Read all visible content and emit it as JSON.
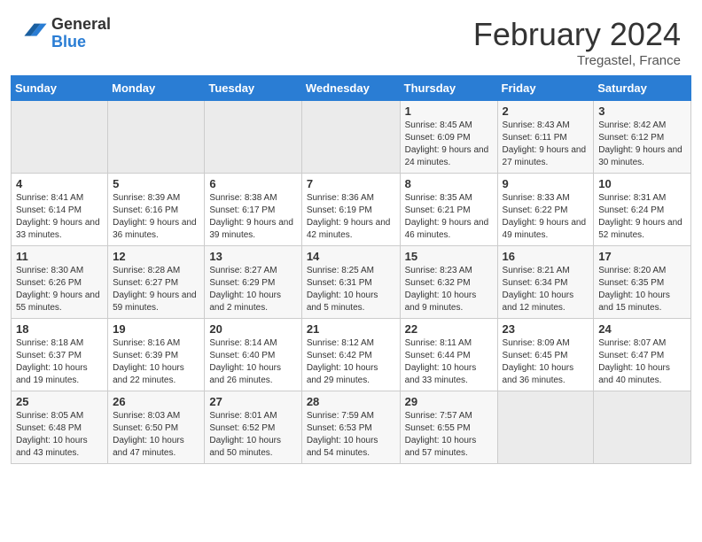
{
  "header": {
    "logo": {
      "line1": "General",
      "line2": "Blue"
    },
    "title": "February 2024",
    "subtitle": "Tregastel, France"
  },
  "weekdays": [
    "Sunday",
    "Monday",
    "Tuesday",
    "Wednesday",
    "Thursday",
    "Friday",
    "Saturday"
  ],
  "weeks": [
    [
      {
        "day": "",
        "info": ""
      },
      {
        "day": "",
        "info": ""
      },
      {
        "day": "",
        "info": ""
      },
      {
        "day": "",
        "info": ""
      },
      {
        "day": "1",
        "info": "Sunrise: 8:45 AM\nSunset: 6:09 PM\nDaylight: 9 hours and 24 minutes."
      },
      {
        "day": "2",
        "info": "Sunrise: 8:43 AM\nSunset: 6:11 PM\nDaylight: 9 hours and 27 minutes."
      },
      {
        "day": "3",
        "info": "Sunrise: 8:42 AM\nSunset: 6:12 PM\nDaylight: 9 hours and 30 minutes."
      }
    ],
    [
      {
        "day": "4",
        "info": "Sunrise: 8:41 AM\nSunset: 6:14 PM\nDaylight: 9 hours and 33 minutes."
      },
      {
        "day": "5",
        "info": "Sunrise: 8:39 AM\nSunset: 6:16 PM\nDaylight: 9 hours and 36 minutes."
      },
      {
        "day": "6",
        "info": "Sunrise: 8:38 AM\nSunset: 6:17 PM\nDaylight: 9 hours and 39 minutes."
      },
      {
        "day": "7",
        "info": "Sunrise: 8:36 AM\nSunset: 6:19 PM\nDaylight: 9 hours and 42 minutes."
      },
      {
        "day": "8",
        "info": "Sunrise: 8:35 AM\nSunset: 6:21 PM\nDaylight: 9 hours and 46 minutes."
      },
      {
        "day": "9",
        "info": "Sunrise: 8:33 AM\nSunset: 6:22 PM\nDaylight: 9 hours and 49 minutes."
      },
      {
        "day": "10",
        "info": "Sunrise: 8:31 AM\nSunset: 6:24 PM\nDaylight: 9 hours and 52 minutes."
      }
    ],
    [
      {
        "day": "11",
        "info": "Sunrise: 8:30 AM\nSunset: 6:26 PM\nDaylight: 9 hours and 55 minutes."
      },
      {
        "day": "12",
        "info": "Sunrise: 8:28 AM\nSunset: 6:27 PM\nDaylight: 9 hours and 59 minutes."
      },
      {
        "day": "13",
        "info": "Sunrise: 8:27 AM\nSunset: 6:29 PM\nDaylight: 10 hours and 2 minutes."
      },
      {
        "day": "14",
        "info": "Sunrise: 8:25 AM\nSunset: 6:31 PM\nDaylight: 10 hours and 5 minutes."
      },
      {
        "day": "15",
        "info": "Sunrise: 8:23 AM\nSunset: 6:32 PM\nDaylight: 10 hours and 9 minutes."
      },
      {
        "day": "16",
        "info": "Sunrise: 8:21 AM\nSunset: 6:34 PM\nDaylight: 10 hours and 12 minutes."
      },
      {
        "day": "17",
        "info": "Sunrise: 8:20 AM\nSunset: 6:35 PM\nDaylight: 10 hours and 15 minutes."
      }
    ],
    [
      {
        "day": "18",
        "info": "Sunrise: 8:18 AM\nSunset: 6:37 PM\nDaylight: 10 hours and 19 minutes."
      },
      {
        "day": "19",
        "info": "Sunrise: 8:16 AM\nSunset: 6:39 PM\nDaylight: 10 hours and 22 minutes."
      },
      {
        "day": "20",
        "info": "Sunrise: 8:14 AM\nSunset: 6:40 PM\nDaylight: 10 hours and 26 minutes."
      },
      {
        "day": "21",
        "info": "Sunrise: 8:12 AM\nSunset: 6:42 PM\nDaylight: 10 hours and 29 minutes."
      },
      {
        "day": "22",
        "info": "Sunrise: 8:11 AM\nSunset: 6:44 PM\nDaylight: 10 hours and 33 minutes."
      },
      {
        "day": "23",
        "info": "Sunrise: 8:09 AM\nSunset: 6:45 PM\nDaylight: 10 hours and 36 minutes."
      },
      {
        "day": "24",
        "info": "Sunrise: 8:07 AM\nSunset: 6:47 PM\nDaylight: 10 hours and 40 minutes."
      }
    ],
    [
      {
        "day": "25",
        "info": "Sunrise: 8:05 AM\nSunset: 6:48 PM\nDaylight: 10 hours and 43 minutes."
      },
      {
        "day": "26",
        "info": "Sunrise: 8:03 AM\nSunset: 6:50 PM\nDaylight: 10 hours and 47 minutes."
      },
      {
        "day": "27",
        "info": "Sunrise: 8:01 AM\nSunset: 6:52 PM\nDaylight: 10 hours and 50 minutes."
      },
      {
        "day": "28",
        "info": "Sunrise: 7:59 AM\nSunset: 6:53 PM\nDaylight: 10 hours and 54 minutes."
      },
      {
        "day": "29",
        "info": "Sunrise: 7:57 AM\nSunset: 6:55 PM\nDaylight: 10 hours and 57 minutes."
      },
      {
        "day": "",
        "info": ""
      },
      {
        "day": "",
        "info": ""
      }
    ]
  ]
}
